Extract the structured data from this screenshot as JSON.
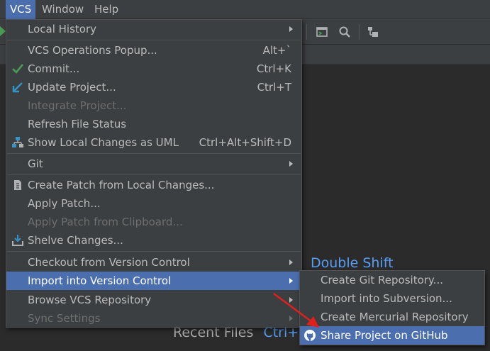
{
  "menubar": {
    "items": [
      {
        "label": "VCS",
        "mnemonic": "V",
        "active": true
      },
      {
        "label": "Window",
        "mnemonic": "W",
        "active": false
      },
      {
        "label": "Help",
        "mnemonic": "H",
        "active": false
      }
    ]
  },
  "toolbar": {
    "icons": [
      "run-icon",
      "console-icon",
      "search-icon",
      "vcs-structure-icon"
    ]
  },
  "editor": {
    "hints": [
      {
        "label": "Double Shift",
        "key": ""
      },
      {
        "label": "Recent Files",
        "key": "Ctrl+E"
      }
    ]
  },
  "vcs_menu": {
    "items": [
      {
        "label": "Local History",
        "shortcut": "",
        "submenu": true,
        "icon": "",
        "disabled": false
      },
      {
        "label": "VCS Operations Popup...",
        "shortcut": "Alt+`",
        "submenu": false,
        "icon": "",
        "disabled": false
      },
      {
        "label": "Commit...",
        "shortcut": "Ctrl+K",
        "submenu": false,
        "icon": "checkmark-icon",
        "disabled": false
      },
      {
        "label": "Update Project...",
        "shortcut": "Ctrl+T",
        "submenu": false,
        "icon": "update-arrow-icon",
        "disabled": false
      },
      {
        "label": "Integrate Project...",
        "shortcut": "",
        "submenu": false,
        "icon": "",
        "disabled": true
      },
      {
        "label": "Refresh File Status",
        "shortcut": "",
        "submenu": false,
        "icon": "",
        "disabled": false
      },
      {
        "label": "Show Local Changes as UML",
        "shortcut": "Ctrl+Alt+Shift+D",
        "submenu": false,
        "icon": "uml-icon",
        "disabled": false
      },
      {
        "label": "Git",
        "shortcut": "",
        "submenu": true,
        "icon": "",
        "disabled": false
      },
      {
        "label": "Create Patch from Local Changes...",
        "shortcut": "",
        "submenu": false,
        "icon": "patch-icon",
        "disabled": false
      },
      {
        "label": "Apply Patch...",
        "shortcut": "",
        "submenu": false,
        "icon": "",
        "disabled": false
      },
      {
        "label": "Apply Patch from Clipboard...",
        "shortcut": "",
        "submenu": false,
        "icon": "",
        "disabled": true
      },
      {
        "label": "Shelve Changes...",
        "shortcut": "",
        "submenu": false,
        "icon": "shelve-icon",
        "disabled": false
      },
      {
        "label": "Checkout from Version Control",
        "shortcut": "",
        "submenu": true,
        "icon": "",
        "disabled": false
      },
      {
        "label": "Import into Version Control",
        "shortcut": "",
        "submenu": true,
        "icon": "",
        "disabled": false,
        "selected": true
      },
      {
        "label": "Browse VCS Repository",
        "shortcut": "",
        "submenu": true,
        "icon": "",
        "disabled": false
      },
      {
        "label": "Sync Settings",
        "shortcut": "",
        "submenu": true,
        "icon": "",
        "disabled": true
      }
    ]
  },
  "import_submenu": {
    "items": [
      {
        "label": "Create Git Repository...",
        "icon": "",
        "selected": false
      },
      {
        "label": "Import into Subversion...",
        "icon": "",
        "selected": false
      },
      {
        "label": "Create Mercurial Repository",
        "icon": "",
        "selected": false
      },
      {
        "label": "Share Project on GitHub",
        "icon": "github-icon",
        "selected": true
      }
    ]
  },
  "colors": {
    "accent": "#4b6eaf",
    "menu_bg": "#3c3f41",
    "editor_bg": "#2b2b2b",
    "annotation_arrow": "#e0201b"
  }
}
